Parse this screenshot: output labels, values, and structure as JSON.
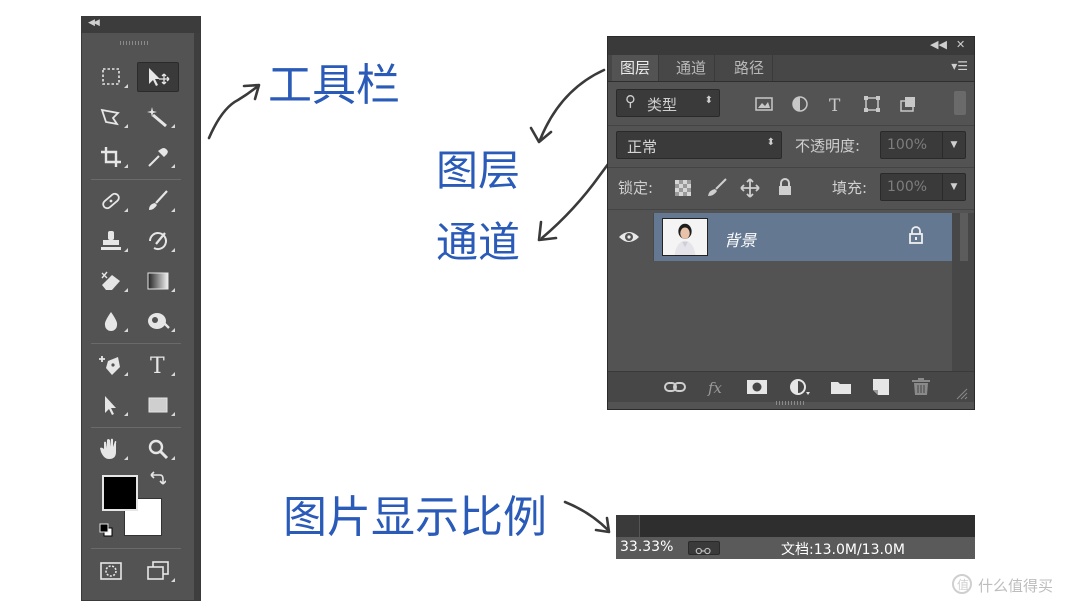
{
  "annotations": {
    "toolbar": "工具栏",
    "layers": "图层",
    "channels": "通道",
    "zoom": "图片显示比例"
  },
  "layers_panel": {
    "tabs": [
      "图层",
      "通道",
      "路径"
    ],
    "filter_label": "类型",
    "blend_mode": "正常",
    "opacity_label": "不透明度:",
    "opacity_value": "100%",
    "lock_label": "锁定:",
    "fill_label": "填充:",
    "fill_value": "100%",
    "layer_name": "背景"
  },
  "status_bar": {
    "zoom": "33.33%",
    "doc_info": "文档:13.0M/13.0M"
  },
  "watermark": "什么值得买",
  "colors": {
    "accent_blue": "#2a5bb8",
    "panel_bg": "#535353",
    "layer_selected": "#647891"
  }
}
